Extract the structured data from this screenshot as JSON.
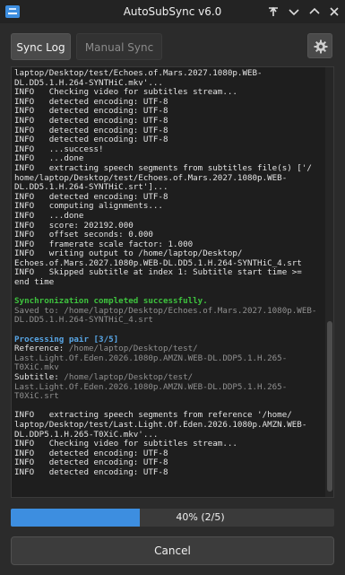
{
  "window": {
    "title": "AutoSubSync v6.0"
  },
  "tabs": [
    {
      "label": "Sync Log",
      "active": true
    },
    {
      "label": "Manual Sync",
      "active": false
    }
  ],
  "log": {
    "lines": [
      {
        "text": "laptop/Desktop/test/Echoes.of.Mars.2027.1080p.WEB-",
        "style": ""
      },
      {
        "text": "DL.DD5.1.H.264-SYNTHiC.mkv'...",
        "style": ""
      },
      {
        "text": "INFO   Checking video for subtitles stream...",
        "style": ""
      },
      {
        "text": "INFO   detected encoding: UTF-8",
        "style": ""
      },
      {
        "text": "INFO   detected encoding: UTF-8",
        "style": ""
      },
      {
        "text": "INFO   detected encoding: UTF-8",
        "style": ""
      },
      {
        "text": "INFO   detected encoding: UTF-8",
        "style": ""
      },
      {
        "text": "INFO   detected encoding: UTF-8",
        "style": ""
      },
      {
        "text": "INFO   ...success!",
        "style": ""
      },
      {
        "text": "INFO   ...done",
        "style": ""
      },
      {
        "text": "INFO   extracting speech segments from subtitles file(s) ['/",
        "style": ""
      },
      {
        "text": "home/laptop/Desktop/test/Echoes.of.Mars.2027.1080p.WEB-",
        "style": ""
      },
      {
        "text": "DL.DD5.1.H.264-SYNTHiC.srt']...",
        "style": ""
      },
      {
        "text": "INFO   detected encoding: UTF-8",
        "style": ""
      },
      {
        "text": "INFO   computing alignments...",
        "style": ""
      },
      {
        "text": "INFO   ...done",
        "style": ""
      },
      {
        "text": "INFO   score: 202192.000",
        "style": ""
      },
      {
        "text": "INFO   offset seconds: 0.000",
        "style": ""
      },
      {
        "text": "INFO   framerate scale factor: 1.000",
        "style": ""
      },
      {
        "text": "INFO   writing output to /home/laptop/Desktop/",
        "style": ""
      },
      {
        "text": "Echoes.of.Mars.2027.1080p.WEB-DL.DD5.1.H.264-SYNTHiC_4.srt",
        "style": ""
      },
      {
        "text": "INFO   Skipped subtitle at index 1: Subtitle start time >=",
        "style": ""
      },
      {
        "text": "end time",
        "style": ""
      },
      {
        "text": "",
        "style": ""
      },
      {
        "text": "Synchronization completed successfully.",
        "style": "green"
      },
      {
        "text": "Saved to: /home/laptop/Desktop/Echoes.of.Mars.2027.1080p.WEB-",
        "style": "gray"
      },
      {
        "text": "DL.DD5.1.H.264-SYNTHiC_4.srt",
        "style": "gray"
      },
      {
        "text": "",
        "style": ""
      },
      {
        "text": "Processing pair [3/5]",
        "style": "blue"
      },
      {
        "text": "Reference: /home/laptop/Desktop/test/",
        "style": "ref"
      },
      {
        "text": "Last.Light.Of.Eden.2026.1080p.AMZN.WEB-DL.DDP5.1.H.265-",
        "style": "dim"
      },
      {
        "text": "T0XiC.mkv",
        "style": "dim"
      },
      {
        "text": "Subtitle: /home/laptop/Desktop/test/",
        "style": "sub"
      },
      {
        "text": "Last.Light.Of.Eden.2026.1080p.AMZN.WEB-DL.DDP5.1.H.265-",
        "style": "dim"
      },
      {
        "text": "T0XiC.srt",
        "style": "dim"
      },
      {
        "text": "",
        "style": ""
      },
      {
        "text": "INFO   extracting speech segments from reference '/home/",
        "style": ""
      },
      {
        "text": "laptop/Desktop/test/Last.Light.Of.Eden.2026.1080p.AMZN.WEB-",
        "style": ""
      },
      {
        "text": "DL.DDP5.1.H.265-T0XiC.mkv'...",
        "style": ""
      },
      {
        "text": "INFO   Checking video for subtitles stream...",
        "style": ""
      },
      {
        "text": "INFO   detected encoding: UTF-8",
        "style": ""
      },
      {
        "text": "INFO   detected encoding: UTF-8",
        "style": ""
      },
      {
        "text": "INFO   detected encoding: UTF-8",
        "style": ""
      }
    ]
  },
  "progress": {
    "fraction": 0.4,
    "label": "40% (2/5)"
  },
  "cancel_label": "Cancel",
  "icons": {
    "app": "app-logo-icon",
    "pin": "pin-icon",
    "minimize": "chevron-down-icon",
    "maximize": "chevron-up-icon",
    "close": "close-icon",
    "settings": "gear-icon"
  },
  "colors": {
    "accent": "#3d8ee0",
    "success": "#3ec33e",
    "info_heading": "#58a6e6"
  }
}
